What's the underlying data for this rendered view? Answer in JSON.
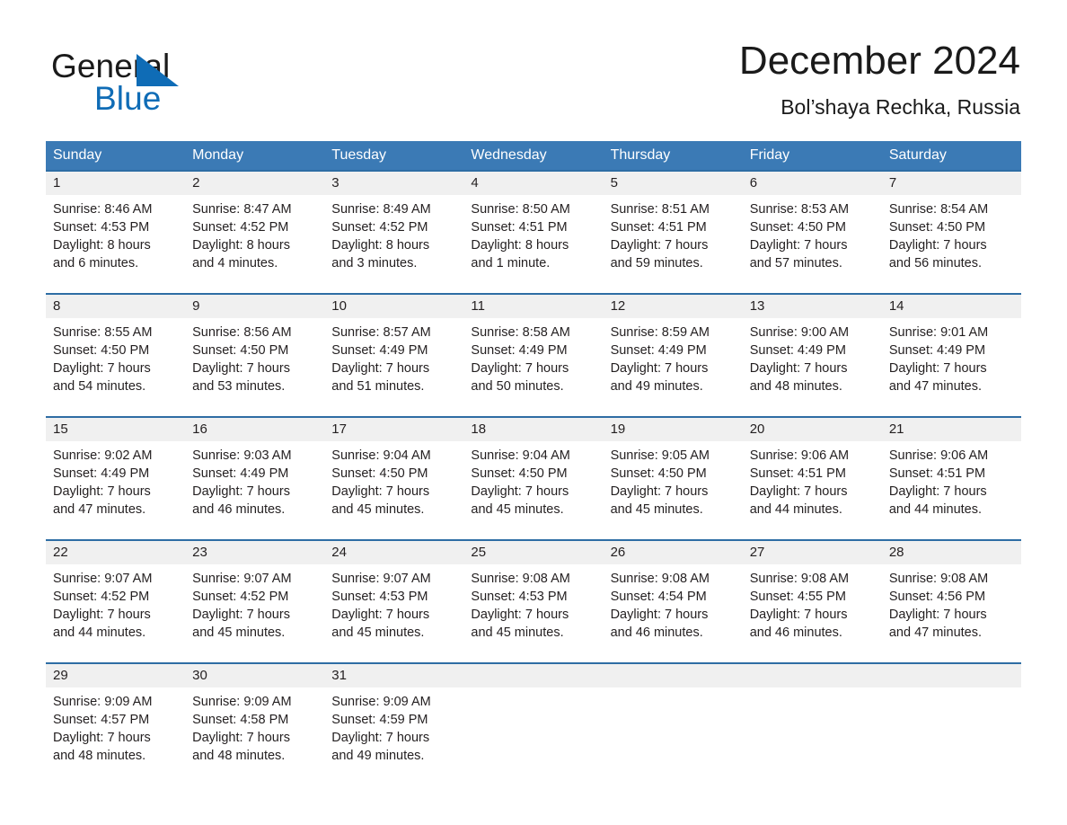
{
  "brand": {
    "word_one": "General",
    "word_two": "Blue",
    "flag_icon": "triangle-flag-icon",
    "blue": "#0f6cb6"
  },
  "header": {
    "title": "December 2024",
    "subtitle": "Bol’shaya Rechka, Russia"
  },
  "theme": {
    "header_blue": "#3b7ab5",
    "rule_blue": "#2e6da4",
    "daynum_band": "#f0f0f0"
  },
  "calendar": {
    "weekdays": [
      "Sunday",
      "Monday",
      "Tuesday",
      "Wednesday",
      "Thursday",
      "Friday",
      "Saturday"
    ],
    "weeks": [
      {
        "days": [
          {
            "date": "1",
            "sunrise": "Sunrise: 8:46 AM",
            "sunset": "Sunset: 4:53 PM",
            "daylight_1": "Daylight: 8 hours",
            "daylight_2": "and 6 minutes."
          },
          {
            "date": "2",
            "sunrise": "Sunrise: 8:47 AM",
            "sunset": "Sunset: 4:52 PM",
            "daylight_1": "Daylight: 8 hours",
            "daylight_2": "and 4 minutes."
          },
          {
            "date": "3",
            "sunrise": "Sunrise: 8:49 AM",
            "sunset": "Sunset: 4:52 PM",
            "daylight_1": "Daylight: 8 hours",
            "daylight_2": "and 3 minutes."
          },
          {
            "date": "4",
            "sunrise": "Sunrise: 8:50 AM",
            "sunset": "Sunset: 4:51 PM",
            "daylight_1": "Daylight: 8 hours",
            "daylight_2": "and 1 minute."
          },
          {
            "date": "5",
            "sunrise": "Sunrise: 8:51 AM",
            "sunset": "Sunset: 4:51 PM",
            "daylight_1": "Daylight: 7 hours",
            "daylight_2": "and 59 minutes."
          },
          {
            "date": "6",
            "sunrise": "Sunrise: 8:53 AM",
            "sunset": "Sunset: 4:50 PM",
            "daylight_1": "Daylight: 7 hours",
            "daylight_2": "and 57 minutes."
          },
          {
            "date": "7",
            "sunrise": "Sunrise: 8:54 AM",
            "sunset": "Sunset: 4:50 PM",
            "daylight_1": "Daylight: 7 hours",
            "daylight_2": "and 56 minutes."
          }
        ]
      },
      {
        "days": [
          {
            "date": "8",
            "sunrise": "Sunrise: 8:55 AM",
            "sunset": "Sunset: 4:50 PM",
            "daylight_1": "Daylight: 7 hours",
            "daylight_2": "and 54 minutes."
          },
          {
            "date": "9",
            "sunrise": "Sunrise: 8:56 AM",
            "sunset": "Sunset: 4:50 PM",
            "daylight_1": "Daylight: 7 hours",
            "daylight_2": "and 53 minutes."
          },
          {
            "date": "10",
            "sunrise": "Sunrise: 8:57 AM",
            "sunset": "Sunset: 4:49 PM",
            "daylight_1": "Daylight: 7 hours",
            "daylight_2": "and 51 minutes."
          },
          {
            "date": "11",
            "sunrise": "Sunrise: 8:58 AM",
            "sunset": "Sunset: 4:49 PM",
            "daylight_1": "Daylight: 7 hours",
            "daylight_2": "and 50 minutes."
          },
          {
            "date": "12",
            "sunrise": "Sunrise: 8:59 AM",
            "sunset": "Sunset: 4:49 PM",
            "daylight_1": "Daylight: 7 hours",
            "daylight_2": "and 49 minutes."
          },
          {
            "date": "13",
            "sunrise": "Sunrise: 9:00 AM",
            "sunset": "Sunset: 4:49 PM",
            "daylight_1": "Daylight: 7 hours",
            "daylight_2": "and 48 minutes."
          },
          {
            "date": "14",
            "sunrise": "Sunrise: 9:01 AM",
            "sunset": "Sunset: 4:49 PM",
            "daylight_1": "Daylight: 7 hours",
            "daylight_2": "and 47 minutes."
          }
        ]
      },
      {
        "days": [
          {
            "date": "15",
            "sunrise": "Sunrise: 9:02 AM",
            "sunset": "Sunset: 4:49 PM",
            "daylight_1": "Daylight: 7 hours",
            "daylight_2": "and 47 minutes."
          },
          {
            "date": "16",
            "sunrise": "Sunrise: 9:03 AM",
            "sunset": "Sunset: 4:49 PM",
            "daylight_1": "Daylight: 7 hours",
            "daylight_2": "and 46 minutes."
          },
          {
            "date": "17",
            "sunrise": "Sunrise: 9:04 AM",
            "sunset": "Sunset: 4:50 PM",
            "daylight_1": "Daylight: 7 hours",
            "daylight_2": "and 45 minutes."
          },
          {
            "date": "18",
            "sunrise": "Sunrise: 9:04 AM",
            "sunset": "Sunset: 4:50 PM",
            "daylight_1": "Daylight: 7 hours",
            "daylight_2": "and 45 minutes."
          },
          {
            "date": "19",
            "sunrise": "Sunrise: 9:05 AM",
            "sunset": "Sunset: 4:50 PM",
            "daylight_1": "Daylight: 7 hours",
            "daylight_2": "and 45 minutes."
          },
          {
            "date": "20",
            "sunrise": "Sunrise: 9:06 AM",
            "sunset": "Sunset: 4:51 PM",
            "daylight_1": "Daylight: 7 hours",
            "daylight_2": "and 44 minutes."
          },
          {
            "date": "21",
            "sunrise": "Sunrise: 9:06 AM",
            "sunset": "Sunset: 4:51 PM",
            "daylight_1": "Daylight: 7 hours",
            "daylight_2": "and 44 minutes."
          }
        ]
      },
      {
        "days": [
          {
            "date": "22",
            "sunrise": "Sunrise: 9:07 AM",
            "sunset": "Sunset: 4:52 PM",
            "daylight_1": "Daylight: 7 hours",
            "daylight_2": "and 44 minutes."
          },
          {
            "date": "23",
            "sunrise": "Sunrise: 9:07 AM",
            "sunset": "Sunset: 4:52 PM",
            "daylight_1": "Daylight: 7 hours",
            "daylight_2": "and 45 minutes."
          },
          {
            "date": "24",
            "sunrise": "Sunrise: 9:07 AM",
            "sunset": "Sunset: 4:53 PM",
            "daylight_1": "Daylight: 7 hours",
            "daylight_2": "and 45 minutes."
          },
          {
            "date": "25",
            "sunrise": "Sunrise: 9:08 AM",
            "sunset": "Sunset: 4:53 PM",
            "daylight_1": "Daylight: 7 hours",
            "daylight_2": "and 45 minutes."
          },
          {
            "date": "26",
            "sunrise": "Sunrise: 9:08 AM",
            "sunset": "Sunset: 4:54 PM",
            "daylight_1": "Daylight: 7 hours",
            "daylight_2": "and 46 minutes."
          },
          {
            "date": "27",
            "sunrise": "Sunrise: 9:08 AM",
            "sunset": "Sunset: 4:55 PM",
            "daylight_1": "Daylight: 7 hours",
            "daylight_2": "and 46 minutes."
          },
          {
            "date": "28",
            "sunrise": "Sunrise: 9:08 AM",
            "sunset": "Sunset: 4:56 PM",
            "daylight_1": "Daylight: 7 hours",
            "daylight_2": "and 47 minutes."
          }
        ]
      },
      {
        "days": [
          {
            "date": "29",
            "sunrise": "Sunrise: 9:09 AM",
            "sunset": "Sunset: 4:57 PM",
            "daylight_1": "Daylight: 7 hours",
            "daylight_2": "and 48 minutes."
          },
          {
            "date": "30",
            "sunrise": "Sunrise: 9:09 AM",
            "sunset": "Sunset: 4:58 PM",
            "daylight_1": "Daylight: 7 hours",
            "daylight_2": "and 48 minutes."
          },
          {
            "date": "31",
            "sunrise": "Sunrise: 9:09 AM",
            "sunset": "Sunset: 4:59 PM",
            "daylight_1": "Daylight: 7 hours",
            "daylight_2": "and 49 minutes."
          },
          {
            "date": "",
            "sunrise": "",
            "sunset": "",
            "daylight_1": "",
            "daylight_2": ""
          },
          {
            "date": "",
            "sunrise": "",
            "sunset": "",
            "daylight_1": "",
            "daylight_2": ""
          },
          {
            "date": "",
            "sunrise": "",
            "sunset": "",
            "daylight_1": "",
            "daylight_2": ""
          },
          {
            "date": "",
            "sunrise": "",
            "sunset": "",
            "daylight_1": "",
            "daylight_2": ""
          }
        ]
      }
    ]
  }
}
